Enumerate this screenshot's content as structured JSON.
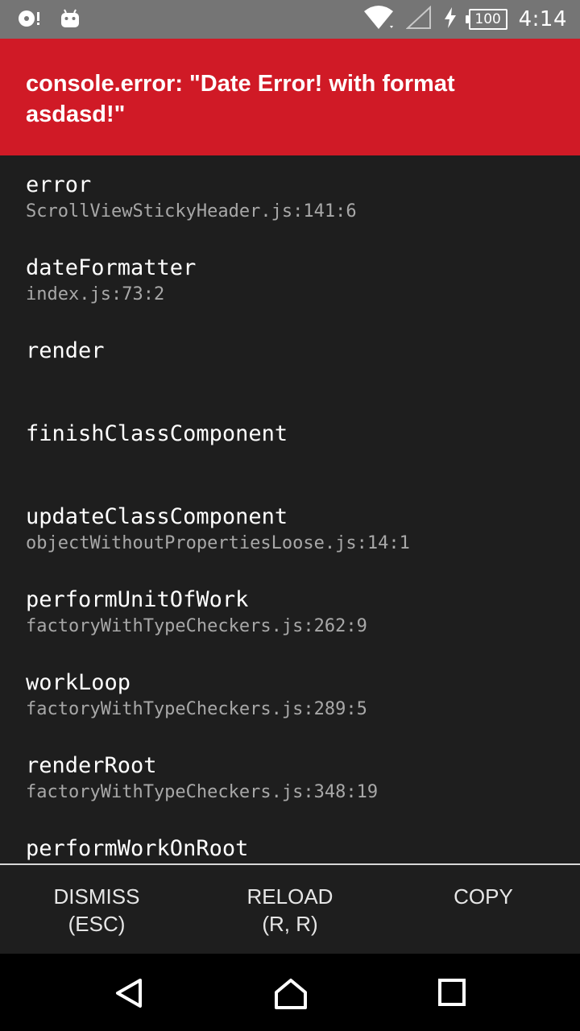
{
  "status_bar": {
    "time": "4:14",
    "battery": "100",
    "icons": [
      "media-icon",
      "android-icon",
      "wifi-icon",
      "signal-icon",
      "charging-icon",
      "battery-icon"
    ]
  },
  "error": {
    "title": "console.error: \"Date Error! with format asdasd!\""
  },
  "stack_frames": [
    {
      "method": "error",
      "location": "ScrollViewStickyHeader.js:141:6"
    },
    {
      "method": "dateFormatter",
      "location": "index.js:73:2"
    },
    {
      "method": "render",
      "location": ""
    },
    {
      "method": "finishClassComponent",
      "location": ""
    },
    {
      "method": "updateClassComponent",
      "location": "objectWithoutPropertiesLoose.js:14:1"
    },
    {
      "method": "performUnitOfWork",
      "location": "factoryWithTypeCheckers.js:262:9"
    },
    {
      "method": "workLoop",
      "location": "factoryWithTypeCheckers.js:289:5"
    },
    {
      "method": "renderRoot",
      "location": "factoryWithTypeCheckers.js:348:19"
    },
    {
      "method": "performWorkOnRoot",
      "location": ""
    }
  ],
  "actions": {
    "dismiss": {
      "line1": "DISMISS",
      "line2": "(ESC)"
    },
    "reload": {
      "line1": "RELOAD",
      "line2": "(R, R)"
    },
    "copy": {
      "line1": "COPY",
      "line2": ""
    }
  },
  "colors": {
    "status_bar": "#757575",
    "error_header": "#d01a26",
    "background": "#1e1e1e",
    "nav_bar": "#000000"
  }
}
